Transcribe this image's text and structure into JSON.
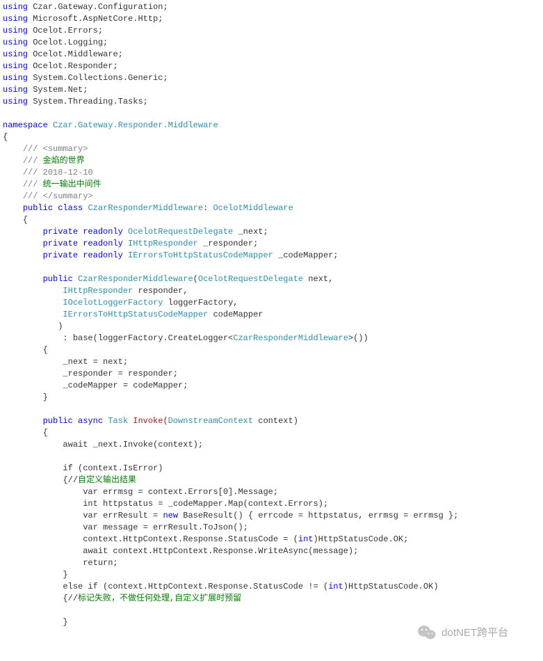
{
  "code": {
    "using": [
      "Czar.Gateway.Configuration",
      "Microsoft.AspNetCore.Http",
      "Ocelot.Errors",
      "Ocelot.Logging",
      "Ocelot.Middleware",
      "Ocelot.Responder",
      "System.Collections.Generic",
      "System.Net",
      "System.Threading.Tasks"
    ],
    "namespace": "Czar.Gateway.Responder.Middleware",
    "doc": {
      "open": "/// <summary>",
      "l1": "/// ",
      "l1c": "金焰的世界",
      "l2": "/// 2018-12-10",
      "l3": "/// ",
      "l3c": "统一输出中间件",
      "close": "/// </summary>"
    },
    "classDecl": {
      "mods": "public class ",
      "name": "CzarResponderMiddleware",
      "sep": ": ",
      "base": "OcelotMiddleware"
    },
    "fields": [
      {
        "mods": "private readonly ",
        "type": "OcelotRequestDelegate",
        "name": " _next;"
      },
      {
        "mods": "private readonly ",
        "type": "IHttpResponder",
        "name": " _responder;"
      },
      {
        "mods": "private readonly ",
        "type": "IErrorsToHttpStatusCodeMapper",
        "name": " _codeMapper;"
      }
    ],
    "ctor": {
      "sigStart": "public ",
      "name": "CzarResponderMiddleware",
      "p0t": "OcelotRequestDelegate",
      "p0n": " next,",
      "p1t": "IHttpResponder",
      "p1n": " responder,",
      "p2t": "IOcelotLoggerFactory",
      "p2n": " loggerFactory,",
      "p3t": "IErrorsToHttpStatusCodeMapper",
      "p3n": " codeMapper",
      "baseCall1": ": base(loggerFactory.CreateLogger<",
      "baseCallT": "CzarResponderMiddleware",
      "baseCall2": ">())",
      "b1": "_next = next;",
      "b2": "_responder = responder;",
      "b3": "_codeMapper = codeMapper;"
    },
    "invoke": {
      "sig1": "public async ",
      "sigT": "Task",
      "sigN": " Invoke(",
      "sigP": "DownstreamContext",
      "sigE": " context)",
      "l1": "await _next.Invoke(context);",
      "ifc": "if (context.IsError)",
      "c1": "{//",
      "c1g": "自定义输出结果",
      "b1": "var errmsg = context.Errors[0].Message;",
      "b2": "int httpstatus = _codeMapper.Map(context.Errors);",
      "b3a": "var errResult = ",
      "b3b": "new",
      "b3c": " BaseResult() { errcode = httpstatus, errmsg = errmsg };",
      "b4": "var message = errResult.ToJson();",
      "b5a": "context.HttpContext.Response.StatusCode = (",
      "b5b": "int",
      "b5c": ")HttpStatusCode.OK;",
      "b6": "await context.HttpContext.Response.WriteAsync(message);",
      "b7": "return;",
      "elifa": "else if (context.HttpContext.Response.StatusCode != (",
      "elifb": "int",
      "elifc": ")HttpStatusCode.OK)",
      "c2": "{//",
      "c2g": "标记失败，不做任何处理,自定义扩展时预留"
    }
  },
  "watermark": "dotNET跨平台"
}
